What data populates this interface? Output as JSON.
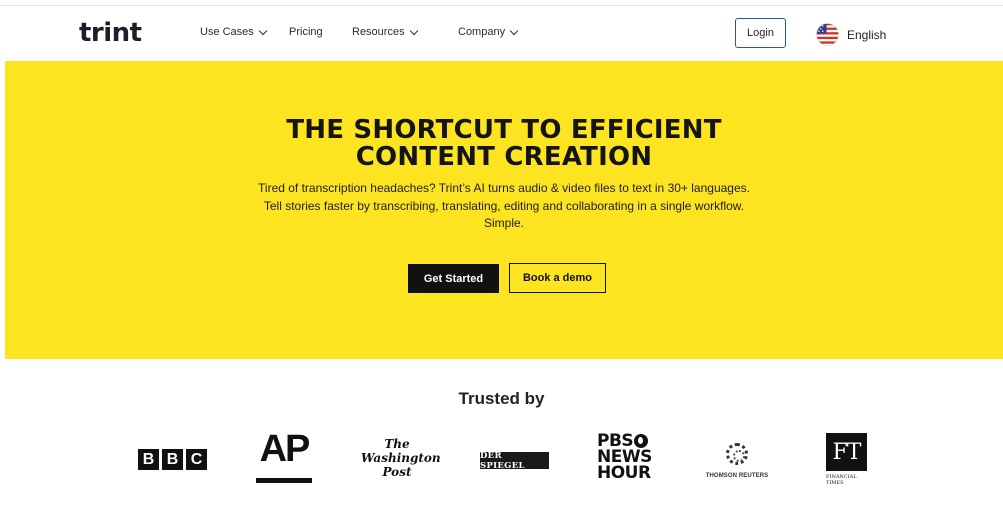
{
  "nav": {
    "logo": "trint",
    "items": [
      {
        "label": "Use Cases",
        "has_dropdown": true
      },
      {
        "label": "Pricing",
        "has_dropdown": false
      },
      {
        "label": "Resources",
        "has_dropdown": true
      },
      {
        "label": "Company",
        "has_dropdown": true
      }
    ],
    "login_label": "Login",
    "language": {
      "label": "English",
      "icon": "us-flag-icon"
    }
  },
  "hero": {
    "title_line1": "THE SHORTCUT TO EFFICIENT",
    "title_line2": "CONTENT CREATION",
    "subtitle": "Tired of transcription headaches? Trint’s AI turns audio & video files to text in 30+ languages. Tell stories faster by transcribing, translating, editing and collaborating in a single workflow. Simple.",
    "primary_cta": "Get Started",
    "secondary_cta": "Book a demo",
    "background_color": "#fde420"
  },
  "trusted": {
    "title": "Trusted by",
    "logos": {
      "bbc": [
        "B",
        "B",
        "C"
      ],
      "ap": "AP",
      "wapo": [
        "The",
        "Washington",
        "Post"
      ],
      "spiegel": "DER SPIEGEL",
      "pbs": [
        "PBS",
        "NEWS",
        "HOUR"
      ],
      "thomson_reuters": "THOMSON REUTERS",
      "ft": {
        "mark": "FT",
        "line1": "FINANCIAL",
        "line2": "TIMES"
      }
    }
  },
  "colors": {
    "accent_yellow": "#fde420",
    "login_border": "#2b4fc7",
    "dark": "#111111"
  }
}
